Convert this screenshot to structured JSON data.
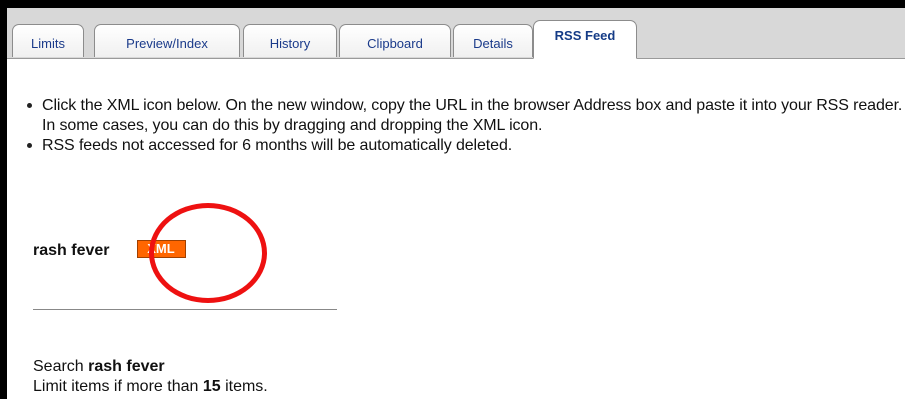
{
  "tabs": [
    {
      "label": "Limits",
      "active": false
    },
    {
      "label": "Preview/Index",
      "active": false
    },
    {
      "label": "History",
      "active": false
    },
    {
      "label": "Clipboard",
      "active": false
    },
    {
      "label": "Details",
      "active": false
    },
    {
      "label": "RSS Feed",
      "active": true
    }
  ],
  "instructions": [
    "Click the XML icon below. On the new window, copy the URL in the browser Address box and paste it into your RSS reader. In some cases, you can do this by dragging and dropping the XML icon.",
    "RSS feeds not accessed for 6 months will be automatically deleted."
  ],
  "feed": {
    "name": "rash fever",
    "xml_label": "XML",
    "xml_color": "#ff6600"
  },
  "annotation": {
    "circle_color": "#ee1111"
  },
  "search": {
    "prefix": "Search ",
    "term": "rash fever"
  },
  "limit": {
    "prefix": "Limit items if more than ",
    "count": "15",
    "suffix": " items."
  }
}
